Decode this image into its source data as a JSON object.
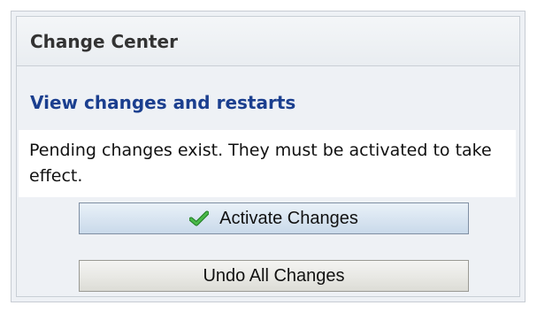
{
  "panel": {
    "title": "Change Center",
    "link_text": "View changes and restarts",
    "message": "Pending changes exist. They must be activated to take effect."
  },
  "buttons": {
    "activate_label": "Activate Changes",
    "undo_label": "Undo All Changes"
  },
  "icons": {
    "activate": "checkmark-icon"
  },
  "colors": {
    "link": "#1b3f8f",
    "checkmark": "#3aa53a"
  }
}
